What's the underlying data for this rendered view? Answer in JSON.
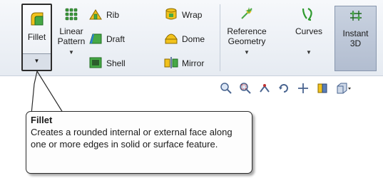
{
  "ribbon": {
    "fillet": {
      "label": "Fillet",
      "icon": "fillet-icon"
    },
    "linear_pattern": {
      "label": "Linear\nPattern",
      "icon": "linear-pattern-icon"
    },
    "rib": {
      "label": "Rib",
      "icon": "rib-icon"
    },
    "draft": {
      "label": "Draft",
      "icon": "draft-icon"
    },
    "shell": {
      "label": "Shell",
      "icon": "shell-icon"
    },
    "wrap": {
      "label": "Wrap",
      "icon": "wrap-icon"
    },
    "dome": {
      "label": "Dome",
      "icon": "dome-icon"
    },
    "mirror": {
      "label": "Mirror",
      "icon": "mirror-icon"
    },
    "reference_geometry": {
      "label": "Reference\nGeometry",
      "icon": "reference-geometry-icon"
    },
    "curves": {
      "label": "Curves",
      "icon": "curves-icon"
    },
    "instant3d": {
      "label": "Instant\n3D",
      "icon": "instant3d-icon"
    }
  },
  "view_toolbar": [
    "zoom-to-fit-icon",
    "zoom-to-area-icon",
    "previous-view-icon",
    "rotate-icon",
    "pan-icon",
    "section-view-icon",
    "view-orientation-icon"
  ],
  "tooltip": {
    "title": "Fillet",
    "body": "Creates a rounded internal or external face along one or more edges in solid or surface feature."
  },
  "colors": {
    "accent": "#3c5a8a",
    "icon_green": "#2e9a2e",
    "icon_yellow": "#f2c21c"
  }
}
